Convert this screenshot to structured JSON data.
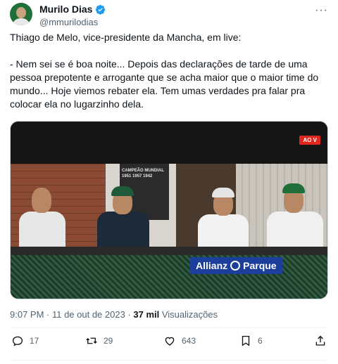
{
  "author": {
    "display_name": "Murilo Dias",
    "handle": "@mmurilodias"
  },
  "tweet": {
    "text": "Thiago de Melo, vice-presidente da Mancha, em live:\n\n- Nem sei se é boa noite... Depois das declarações de tarde de uma pessoa prepotente e arrogante que se acha maior que o maior time do mundo... Hoje viemos rebater ela. Tem umas verdades pra falar pra colocar ela no lugarzinho dela."
  },
  "media": {
    "live_badge": "AO V",
    "poster_text": "CAMPEÃO MUNDIAL 1951 1957 1942",
    "sponsor_word": "Allianz",
    "sponsor_second": "Parque"
  },
  "meta": {
    "time_date": "9:07 PM · 11 de out de 2023 · ",
    "views_count": "37 mil",
    "views_label": " Visualizações"
  },
  "actions": {
    "replies": "17",
    "retweets": "29",
    "likes": "643",
    "bookmarks": "6"
  },
  "colors": {
    "verified_blue": "#1d9bf0",
    "secondary_text": "#536471",
    "live_red": "#e0261d",
    "allianz_blue": "#1b3f9a"
  },
  "icons": [
    "verified-icon",
    "more-icon",
    "reply-icon",
    "retweet-icon",
    "like-icon",
    "bookmark-icon",
    "share-icon"
  ]
}
